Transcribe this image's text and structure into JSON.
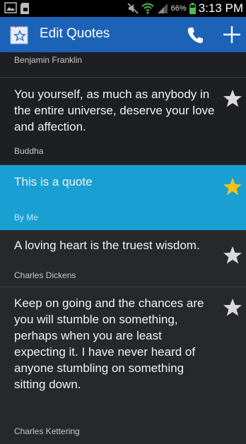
{
  "status_bar": {
    "battery_percent": "66%",
    "time": "3:13 PM"
  },
  "action_bar": {
    "title": "Edit Quotes",
    "colors": {
      "background": "#1c63b8"
    }
  },
  "quotes": [
    {
      "text": "",
      "author": "Benjamin Franklin",
      "starred": false
    },
    {
      "text": "You yourself, as much as anybody in the entire universe, deserve your love and affection.",
      "author": "Buddha",
      "starred": false
    },
    {
      "text": "This is a quote",
      "author": "By Me",
      "starred": true,
      "selected": true
    },
    {
      "text": "A loving heart is the truest wisdom.",
      "author": "Charles Dickens",
      "starred": false
    },
    {
      "text": "Keep on going and the chances are you will stumble on something, perhaps when you are least expecting it. I have never heard of anyone stumbling on something sitting down.",
      "author": "Charles Kettering",
      "starred": false
    }
  ],
  "icons": {
    "app": "star-app-icon",
    "call": "phone-icon",
    "add": "plus-icon",
    "star_empty": "star-outline-icon",
    "star_filled": "star-filled-icon"
  },
  "colors": {
    "selected_row": "#1a9fd3",
    "star_filled": "#f4c21a",
    "star_empty": "#d9d9d9"
  }
}
